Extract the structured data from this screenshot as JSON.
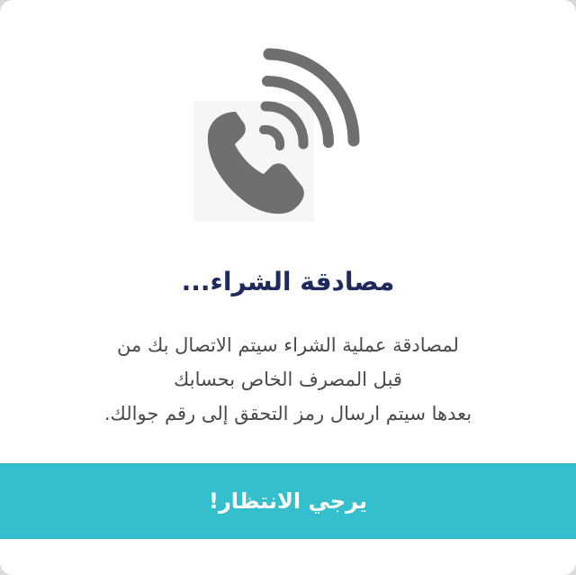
{
  "dialog": {
    "icon": "phone-ringing-icon",
    "title": "مصادقة الشراء...",
    "message_lines": [
      "لمصادقة عملية الشراء سيتم الاتصال بك من",
      "قبل المصرف الخاص بحسابك",
      "بعدها سيتم ارسال رمز التحقق إلى رقم جوالك."
    ],
    "wait_label": "يرجي الانتظار!"
  },
  "colors": {
    "title": "#1f2a5c",
    "message": "#4a4a4a",
    "wait_bar": "#35bfcc",
    "icon": "#6f6f6f"
  }
}
